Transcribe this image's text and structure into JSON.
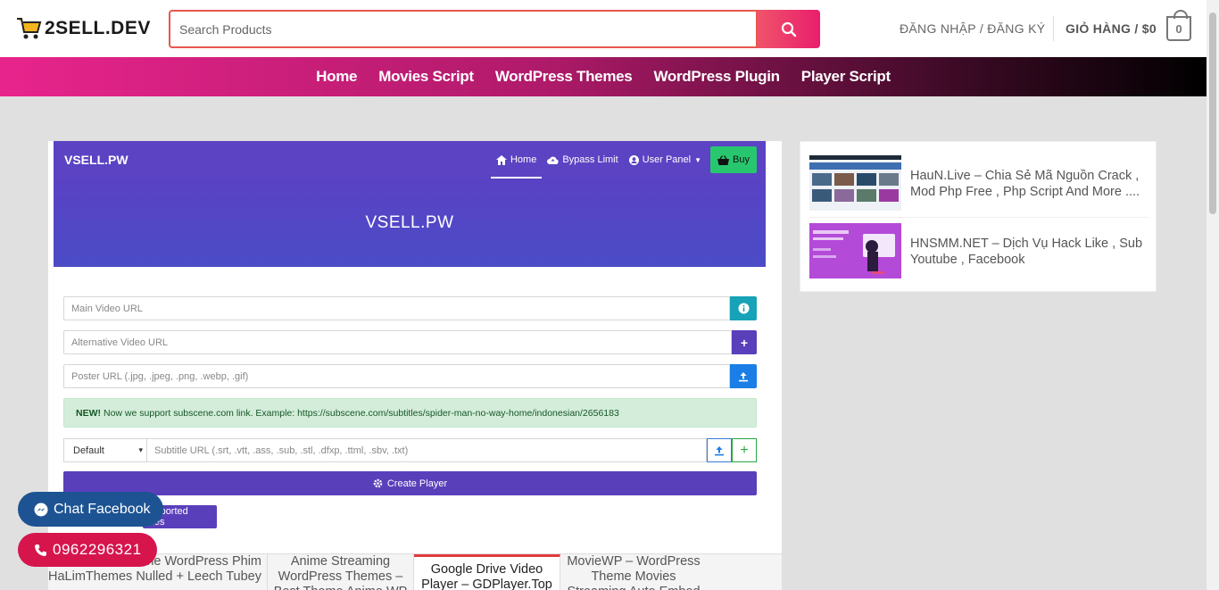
{
  "header": {
    "logo_text": "2SELL.DEV",
    "search_placeholder": "Search Products",
    "login_label": "ĐĂNG NHẬP / ĐĂNG KÝ",
    "cart_label": "GIỎ HÀNG / $0",
    "cart_count": "0"
  },
  "nav": {
    "items": [
      "Home",
      "Movies Script",
      "WordPress Themes",
      "WordPress Plugin",
      "Player Script"
    ]
  },
  "player_app": {
    "brand": "VSELL.PW",
    "nav_home": "Home",
    "nav_bypass": "Bypass Limit",
    "nav_user": "User Panel",
    "nav_buy": "Buy",
    "hero_title": "VSELL.PW",
    "main_video_placeholder": "Main Video URL",
    "alt_video_placeholder": "Alternative Video URL",
    "poster_placeholder": "Poster URL (.jpg, .jpeg, .png, .webp, .gif)",
    "alert_new": "NEW!",
    "alert_text": "Now we support subscene.com link. Example: https://subscene.com/subtitles/spider-man-no-way-home/indonesian/2656183",
    "subtitle_select": "Default",
    "subtitle_placeholder": "Subtitle URL (.srt, .vtt, .ass, .sub, .stl, .dfxp, .ttml, .sbv, .txt)",
    "create_button": "Create Player",
    "supported_button": "Supported Sites"
  },
  "related": [
    "Theme WordPress Phim HaLimThemes Nulled + Leech Tubey",
    "Anime Streaming WordPress Themes – Best Theme Anime WP",
    "Google Drive Video Player – GDPlayer.Top",
    "MovieWP – WordPress Theme Movies Streaming Auto Embed"
  ],
  "sidebar": {
    "items": [
      {
        "title": "HauN.Live – Chia Sẻ Mã Nguồn Crack , Mod Php Free , Php Script And More ...."
      },
      {
        "title": "HNSMM.NET – Dịch Vụ Hack Like , Sub Youtube , Facebook"
      }
    ]
  },
  "floating": {
    "chat_label": "Chat Facebook",
    "phone_label": "0962296321"
  },
  "colors": {
    "accent_pink": "#e8248c",
    "search_red": "#e8584d",
    "player_purple": "#5b43c3",
    "buy_green": "#28c76f",
    "info_teal": "#17a2b8",
    "chat_blue": "#1d5392",
    "phone_red": "#d6154d"
  }
}
